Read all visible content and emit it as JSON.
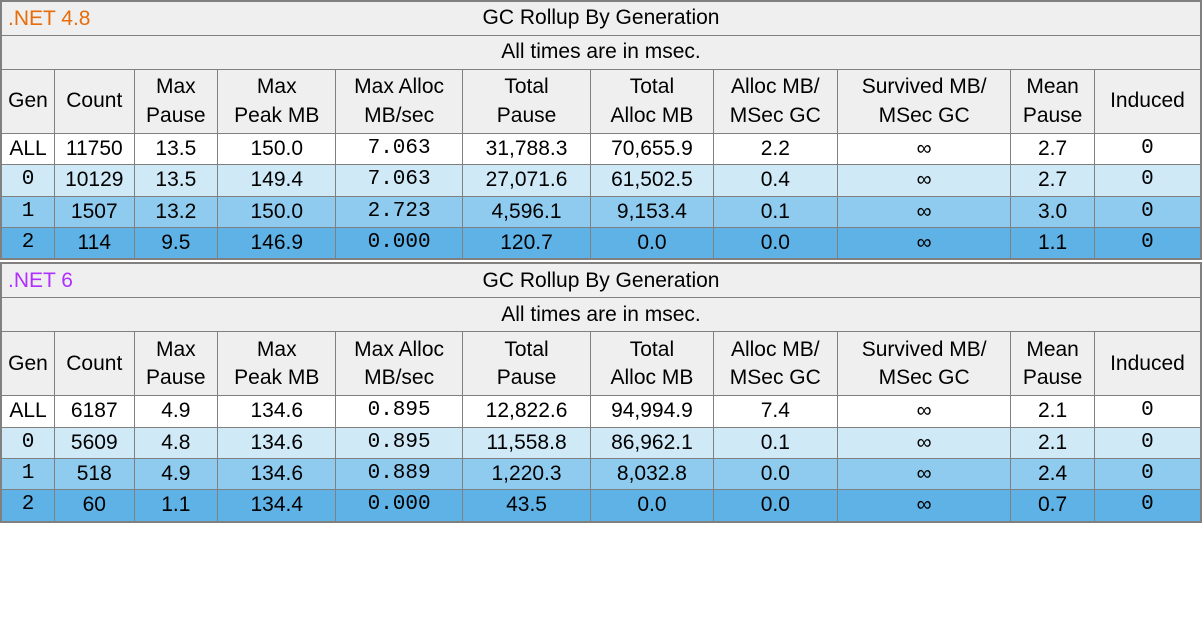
{
  "columns": [
    "Gen",
    "Count",
    "Max Pause",
    "Max Peak MB",
    "Max Alloc MB/sec",
    "Total Pause",
    "Total Alloc MB",
    "Alloc MB/ MSec GC",
    "Survived MB/ MSec GC",
    "Mean Pause",
    "Induced"
  ],
  "column_breaks": {
    "2": "Max\nPause",
    "3": "Max\nPeak MB",
    "4": "Max Alloc\nMB/sec",
    "5": "Total\nPause",
    "6": "Total\nAlloc MB",
    "7": "Alloc MB/\nMSec GC",
    "8": "Survived MB/\nMSec GC",
    "9": "Mean\nPause"
  },
  "panels": [
    {
      "version": ".NET 4.8",
      "version_color_class": "orange",
      "title": "GC Rollup By Generation",
      "subtitle": "All times are in msec.",
      "rows": [
        {
          "shade": "shade0",
          "cells": [
            "ALL",
            "11750",
            "13.5",
            "150.0",
            "7.063",
            "31,788.3",
            "70,655.9",
            "2.2",
            "∞",
            "2.7",
            "0"
          ]
        },
        {
          "shade": "shade1",
          "cells": [
            "0",
            "10129",
            "13.5",
            "149.4",
            "7.063",
            "27,071.6",
            "61,502.5",
            "0.4",
            "∞",
            "2.7",
            "0"
          ]
        },
        {
          "shade": "shade2",
          "cells": [
            "1",
            "1507",
            "13.2",
            "150.0",
            "2.723",
            "4,596.1",
            "9,153.4",
            "0.1",
            "∞",
            "3.0",
            "0"
          ]
        },
        {
          "shade": "shade3",
          "cells": [
            "2",
            "114",
            "9.5",
            "146.9",
            "0.000",
            "120.7",
            "0.0",
            "0.0",
            "∞",
            "1.1",
            "0"
          ]
        }
      ]
    },
    {
      "version": ".NET 6",
      "version_color_class": "magenta",
      "title": "GC Rollup By Generation",
      "subtitle": "All times are in msec.",
      "rows": [
        {
          "shade": "shade0",
          "cells": [
            "ALL",
            "6187",
            "4.9",
            "134.6",
            "0.895",
            "12,822.6",
            "94,994.9",
            "7.4",
            "∞",
            "2.1",
            "0"
          ]
        },
        {
          "shade": "shade1",
          "cells": [
            "0",
            "5609",
            "4.8",
            "134.6",
            "0.895",
            "11,558.8",
            "86,962.1",
            "0.1",
            "∞",
            "2.1",
            "0"
          ]
        },
        {
          "shade": "shade2",
          "cells": [
            "1",
            "518",
            "4.9",
            "134.6",
            "0.889",
            "1,220.3",
            "8,032.8",
            "0.0",
            "∞",
            "2.4",
            "0"
          ]
        },
        {
          "shade": "shade3",
          "cells": [
            "2",
            "60",
            "1.1",
            "134.4",
            "0.000",
            "43.5",
            "0.0",
            "0.0",
            "∞",
            "0.7",
            "0"
          ]
        }
      ]
    }
  ],
  "mono_columns": [
    4,
    10
  ],
  "mono_gen_values": [
    "0",
    "1",
    "2"
  ]
}
